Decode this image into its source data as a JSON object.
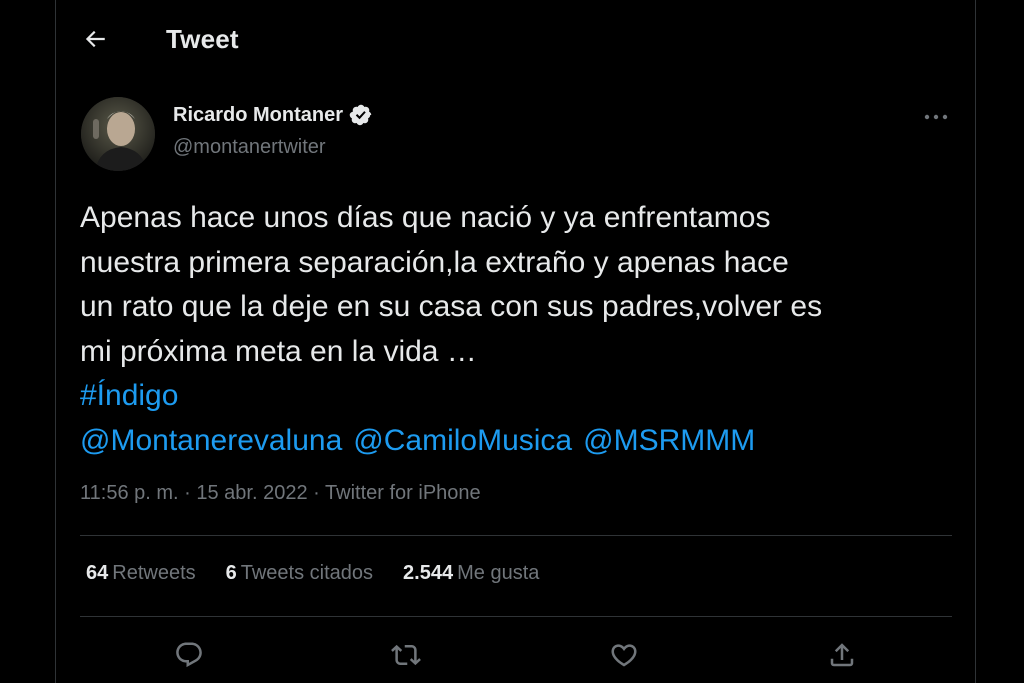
{
  "header": {
    "title": "Tweet",
    "back_icon": "arrow-left-icon"
  },
  "author": {
    "name": "Ricardo Montaner",
    "handle": "@montanertwiter",
    "verified": true,
    "more_icon": "more-horizontal-icon"
  },
  "tweet": {
    "lines": [
      "Apenas hace unos días que nació y ya enfrentamos",
      "nuestra primera separación,la extraño y apenas hace",
      "un rato que la deje en su casa con sus padres,volver es",
      "mi próxima meta en la vida …"
    ],
    "hashtag": "#Índigo",
    "mentions": [
      "@Montanerevaluna",
      "@CamiloMusica",
      "@MSRMMM"
    ]
  },
  "meta": {
    "time": "11:56 p. m.",
    "separator": "·",
    "date": "15 abr. 2022",
    "source": "Twitter for iPhone"
  },
  "stats": {
    "retweets_count": "64",
    "retweets_label": "Retweets",
    "quotes_count": "6",
    "quotes_label": "Tweets citados",
    "likes_count": "2.544",
    "likes_label": "Me gusta"
  },
  "actions": [
    "reply-icon",
    "retweet-icon",
    "like-icon",
    "share-icon"
  ],
  "colors": {
    "background": "#000000",
    "text": "#e7e9ea",
    "secondary": "#71767b",
    "link": "#1d9bf0",
    "border": "#2f3336"
  }
}
